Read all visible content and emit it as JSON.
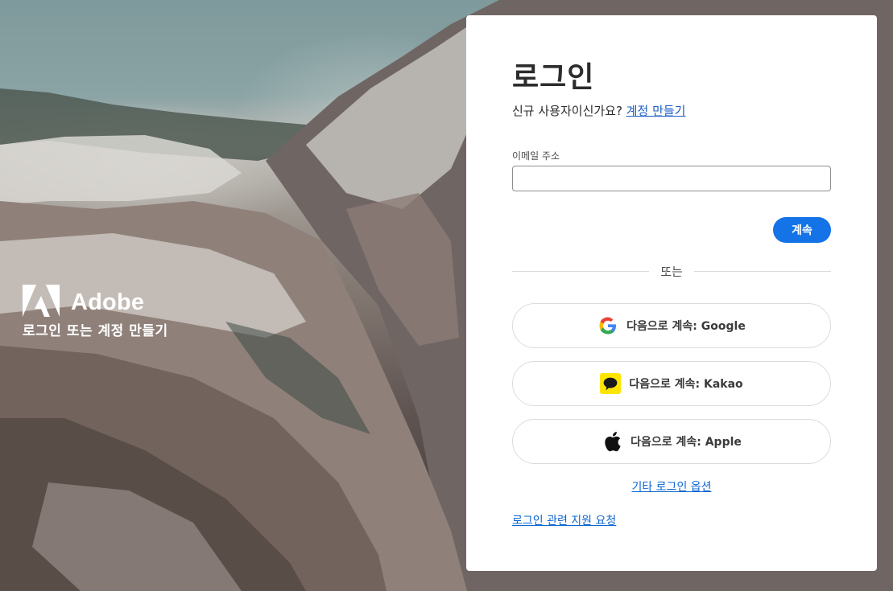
{
  "brand": {
    "name": "Adobe",
    "tagline": "로그인 또는 계정 만들기"
  },
  "signin": {
    "title": "로그인",
    "new_user_prompt": "신규 사용자이신가요?",
    "create_account_link": "계정 만들기",
    "email_label": "이메일 주소",
    "email_value": "",
    "email_placeholder": "",
    "continue_label": "계속",
    "divider_text": "또는",
    "social": [
      {
        "label": "다음으로 계속: Google",
        "icon": "google-icon"
      },
      {
        "label": "다음으로 계속: Kakao",
        "icon": "kakao-icon"
      },
      {
        "label": "다음으로 계속: Apple",
        "icon": "apple-icon"
      }
    ],
    "other_options_link": "기타 로그인 옵션",
    "help_link": "로그인 관련 지원 요청"
  },
  "colors": {
    "primary": "#1473e6",
    "link": "#0d66d0",
    "kakao_yellow": "#fee500",
    "adobe_red": "#ffffff"
  }
}
